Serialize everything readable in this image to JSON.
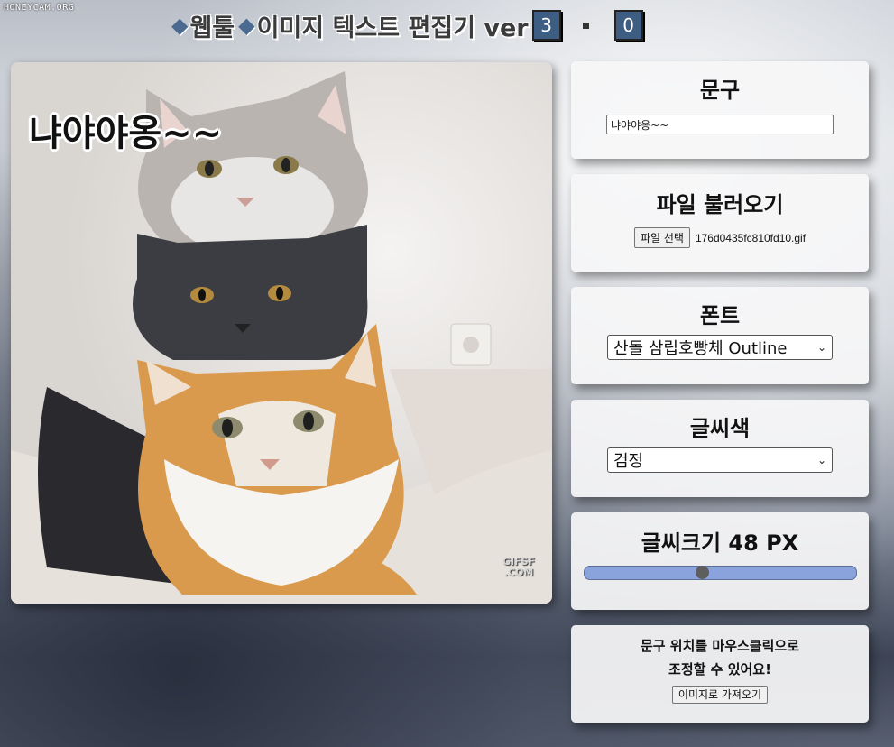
{
  "watermark": "HONEYCAM.ORG",
  "header": {
    "title_part1": "웹툴",
    "title_part2": "이미지 텍스트 편집기 ver",
    "version_major": "3",
    "version_minor": "0"
  },
  "canvas": {
    "overlay_text": "냐야야옹~~",
    "gif_watermark_line1": "GIFSF",
    "gif_watermark_line2": ".COM"
  },
  "phrase_card": {
    "heading": "문구",
    "input_value": "냐야야옹~~"
  },
  "file_card": {
    "heading": "파일 불러오기",
    "button_label": "파일 선택",
    "file_name": "176d0435fc810fd10.gif"
  },
  "font_card": {
    "heading": "폰트",
    "selected": "산돌 삼립호빵체 Outline"
  },
  "color_card": {
    "heading": "글씨색",
    "selected": "검정"
  },
  "size_card": {
    "heading": "글씨크기 48 PX",
    "slider_fraction": 0.43
  },
  "note_card": {
    "line1": "문구 위치를 마우스클릭으로",
    "line2": "조정할 수 있어요!",
    "button_label": "이미지로 가져오기"
  },
  "colors": {
    "accent_blue": "#3e5d82",
    "slider_track": "#8aa3dc"
  }
}
